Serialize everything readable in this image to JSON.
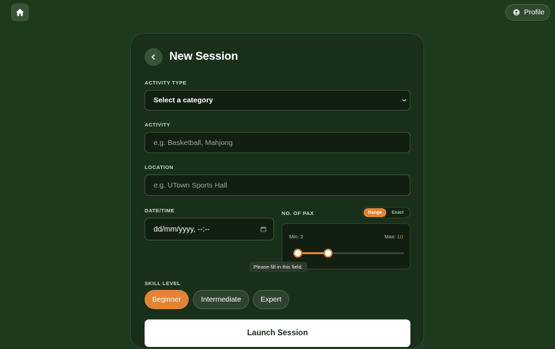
{
  "profile": {
    "label": "Profile",
    "icon": "user-circle-icon"
  },
  "home": {
    "icon": "home-icon"
  },
  "form": {
    "title": "New Session",
    "back_icon": "chevron-left-icon",
    "activity_type": {
      "label": "ACTIVITY TYPE",
      "value": "Select a category"
    },
    "activity": {
      "label": "ACTIVITY",
      "placeholder": "e.g. Basketball, Mahjong"
    },
    "location": {
      "label": "LOCATION",
      "placeholder": "e.g. UTown Sports Hall"
    },
    "datetime": {
      "label": "DATE/TIME",
      "value": "dd/mm/yyyy, --:--"
    },
    "pax": {
      "label": "NO. OF PAX",
      "modes": [
        "Range",
        "Exact"
      ],
      "selected_mode": "Range",
      "min_label": "Min: 2",
      "max_prefix": "Max:",
      "max_value": "10",
      "slider": {
        "scale_max": 30,
        "min": 2,
        "max": 10
      }
    },
    "tooltip": "Please fill in this field.",
    "skill": {
      "label": "SKILL LEVEL",
      "options": [
        "Beginner",
        "Intermediate",
        "Expert"
      ],
      "selected": "Beginner"
    },
    "submit_label": "Launch Session"
  },
  "colors": {
    "accent": "#e38433",
    "background": "#1e3a1e",
    "card": "#1a2f1a"
  }
}
